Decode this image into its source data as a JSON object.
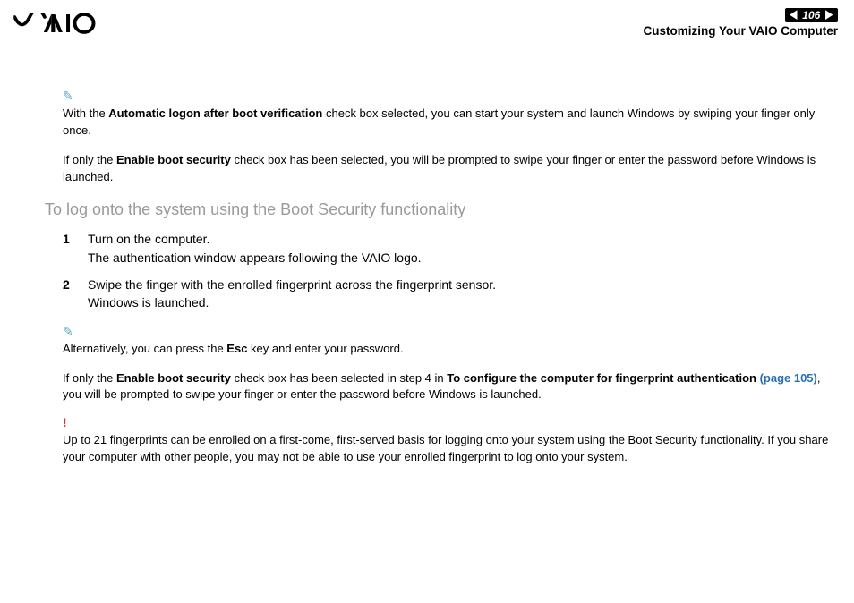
{
  "header": {
    "logo_text": "VAIO",
    "page_number": "106",
    "section_title": "Customizing Your VAIO Computer"
  },
  "note1": {
    "pre": "With the ",
    "bold": "Automatic logon after boot verification",
    "post": " check box selected, you can start your system and launch Windows by swiping your finger only once."
  },
  "note1b": {
    "pre": "If only the ",
    "bold": "Enable boot security",
    "post": " check box has been selected, you will be prompted to swipe your finger or enter the password before Windows is launched."
  },
  "heading": "To log onto the system using the Boot Security functionality",
  "steps": [
    {
      "num": "1",
      "line1": "Turn on the computer.",
      "line2": "The authentication window appears following the VAIO logo."
    },
    {
      "num": "2",
      "line1": "Swipe the finger with the enrolled fingerprint across the fingerprint sensor.",
      "line2": "Windows is launched."
    }
  ],
  "note2": {
    "pre": "Alternatively, you can press the ",
    "bold": "Esc",
    "post": " key and enter your password."
  },
  "note2b": {
    "pre": "If only the ",
    "bold1": "Enable boot security",
    "mid": " check box has been selected in step 4 in ",
    "bold2": "To configure the computer for fingerprint authentication ",
    "link": "(page 105)",
    "post": ", you will be prompted to swipe your finger or enter the password before Windows is launched."
  },
  "warning": "Up to 21 fingerprints can be enrolled on a first-come, first-served basis for logging onto your system using the Boot Security functionality. If you share your computer with other people, you may not be able to use your enrolled fingerprint to log onto your system."
}
